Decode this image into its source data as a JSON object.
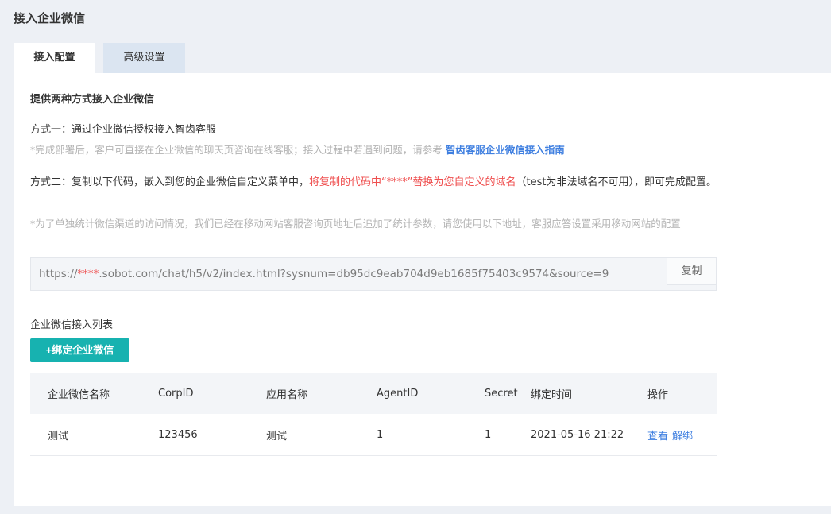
{
  "page": {
    "title": "接入企业微信"
  },
  "tabs": [
    {
      "label": "接入配置",
      "active": true
    },
    {
      "label": "高级设置",
      "active": false
    }
  ],
  "intro": "提供两种方式接入企业微信",
  "method1": {
    "title": "方式一：通过企业微信授权接入智齿客服",
    "note": "*完成部署后，客户可直接在企业微信的聊天页咨询在线客服；接入过程中若遇到问题，请参考 ",
    "link": "智齿客服企业微信接入指南"
  },
  "method2": {
    "text_a": "方式二：复制以下代码，嵌入到您的企业微信自定义菜单中，",
    "text_red": "将复制的代码中“****”替换为您自定义的域名",
    "text_b": "（test为非法域名不可用），即可完成配置。",
    "note": "*为了单独统计微信渠道的访问情况，我们已经在移动网站客服咨询页地址后追加了统计参数，请您使用以下地址，客服应答设置采用移动网站的配置"
  },
  "url": {
    "prefix": "https://",
    "stars": "****",
    "suffix": ".sobot.com/chat/h5/v2/index.html?sysnum=db95dc9eab704d9eb1685f75403c9574&source=9",
    "copy_label": "复制"
  },
  "list": {
    "title": "企业微信接入列表",
    "bind_label": "+绑定企业微信",
    "headers": [
      "企业微信名称",
      "CorpID",
      "应用名称",
      "AgentID",
      "Secret",
      "绑定时间",
      "操作"
    ],
    "rows": [
      {
        "name": "测试",
        "corpid": "123456",
        "app": "测试",
        "agentid": "1",
        "secret": "1",
        "time": "2021-05-16 21:22",
        "view": "查看",
        "unbind": "解绑"
      }
    ]
  }
}
